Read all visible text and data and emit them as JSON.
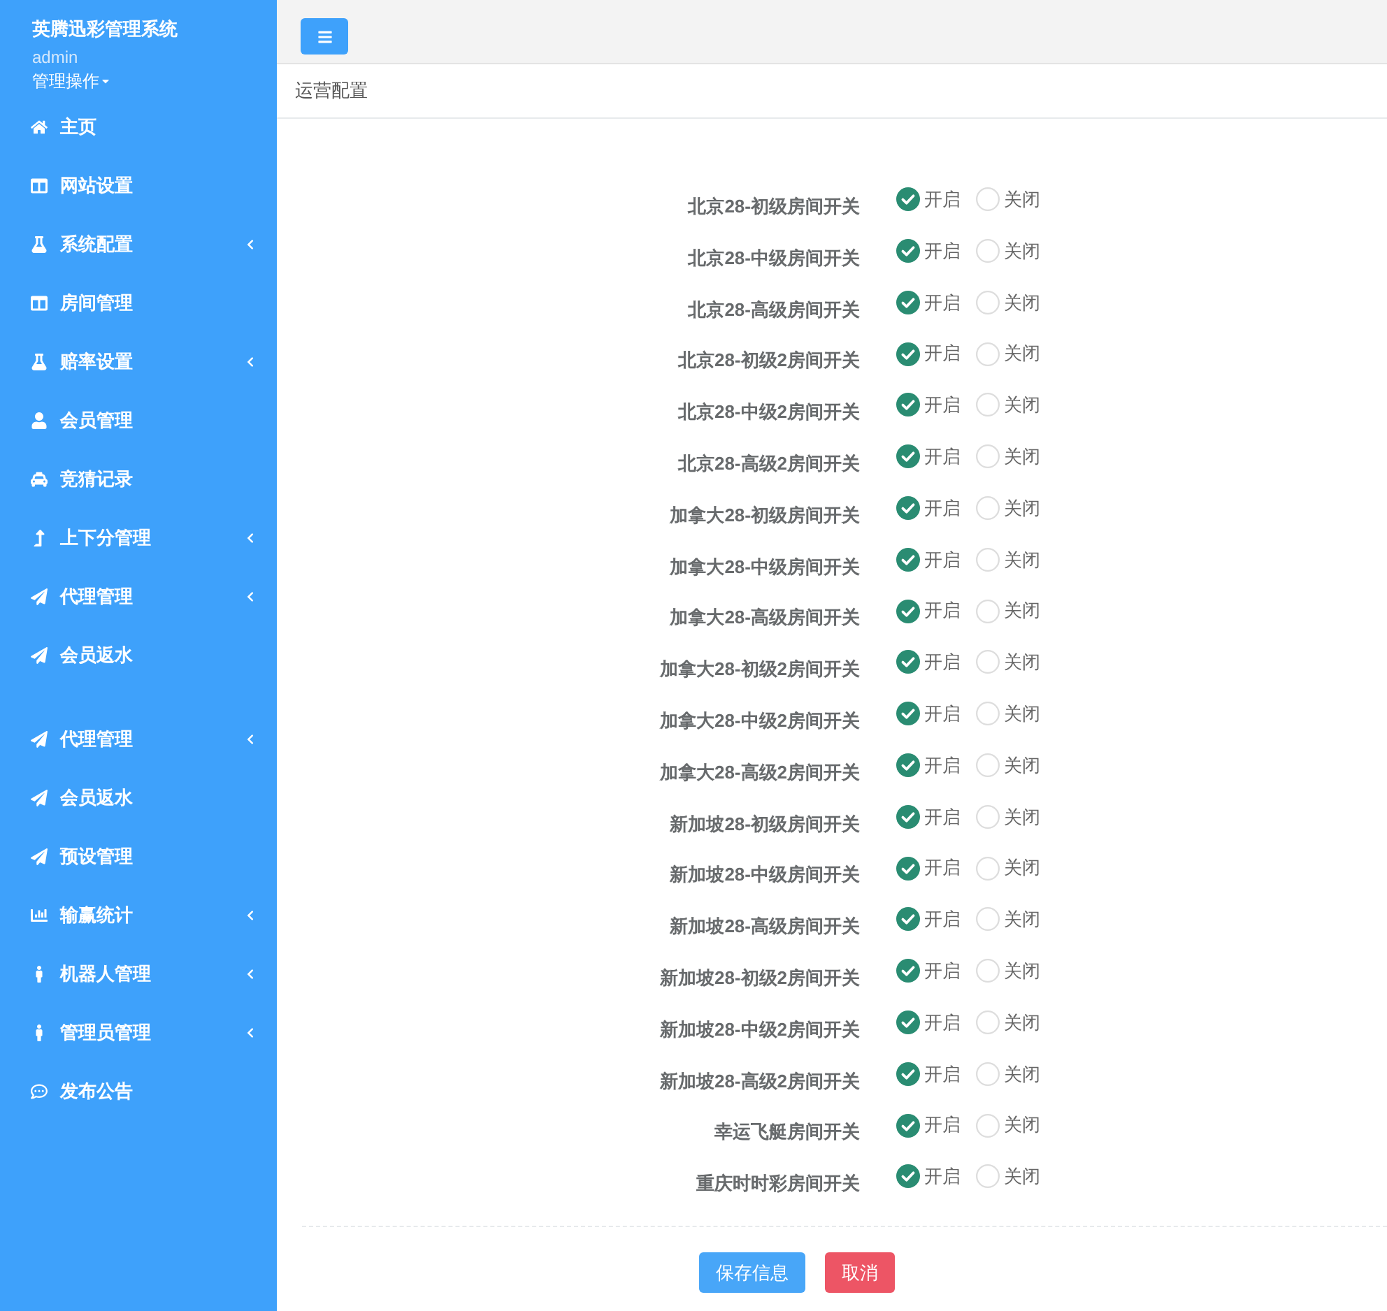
{
  "sidebar": {
    "title": "英腾迅彩管理系统",
    "user": "admin",
    "user_menu": "管理操作",
    "menu_groups": [
      {
        "items": [
          {
            "label": "主页",
            "expandable": false
          },
          {
            "label": "网站设置",
            "expandable": false
          },
          {
            "label": "系统配置",
            "expandable": true
          },
          {
            "label": "房间管理",
            "expandable": false
          },
          {
            "label": "赔率设置",
            "expandable": true
          },
          {
            "label": "会员管理",
            "expandable": false
          },
          {
            "label": "竞猜记录",
            "expandable": false
          },
          {
            "label": "上下分管理",
            "expandable": true
          },
          {
            "label": "代理管理",
            "expandable": true
          },
          {
            "label": "会员返水",
            "expandable": false
          }
        ]
      },
      {
        "items": [
          {
            "label": "代理管理",
            "expandable": true
          },
          {
            "label": "会员返水",
            "expandable": false
          },
          {
            "label": "预设管理",
            "expandable": false
          },
          {
            "label": "输赢统计",
            "expandable": true
          },
          {
            "label": "机器人管理",
            "expandable": true
          },
          {
            "label": "管理员管理",
            "expandable": true
          },
          {
            "label": "发布公告",
            "expandable": false
          }
        ]
      }
    ]
  },
  "page": {
    "title": "运营配置"
  },
  "form": {
    "rows": [
      {
        "label": "北京28-初级房间开关",
        "options": [
          {
            "label": "开启",
            "selected": true
          },
          {
            "label": "关闭",
            "selected": false
          }
        ]
      },
      {
        "label": "北京28-中级房间开关",
        "options": [
          {
            "label": "开启",
            "selected": true
          },
          {
            "label": "关闭",
            "selected": false
          }
        ]
      },
      {
        "label": "北京28-高级房间开关",
        "options": [
          {
            "label": "开启",
            "selected": true
          },
          {
            "label": "关闭",
            "selected": false
          }
        ]
      },
      {
        "label": "北京28-初级2房间开关",
        "options": [
          {
            "label": "开启",
            "selected": true
          },
          {
            "label": "关闭",
            "selected": false
          }
        ]
      },
      {
        "label": "北京28-中级2房间开关",
        "options": [
          {
            "label": "开启",
            "selected": true
          },
          {
            "label": "关闭",
            "selected": false
          }
        ]
      },
      {
        "label": "北京28-高级2房间开关",
        "options": [
          {
            "label": "开启",
            "selected": true
          },
          {
            "label": "关闭",
            "selected": false
          }
        ]
      },
      {
        "label": "加拿大28-初级房间开关",
        "options": [
          {
            "label": "开启",
            "selected": true
          },
          {
            "label": "关闭",
            "selected": false
          }
        ]
      },
      {
        "label": "加拿大28-中级房间开关",
        "options": [
          {
            "label": "开启",
            "selected": true
          },
          {
            "label": "关闭",
            "selected": false
          }
        ]
      },
      {
        "label": "加拿大28-高级房间开关",
        "options": [
          {
            "label": "开启",
            "selected": true
          },
          {
            "label": "关闭",
            "selected": false
          }
        ]
      },
      {
        "label": "加拿大28-初级2房间开关",
        "options": [
          {
            "label": "开启",
            "selected": true
          },
          {
            "label": "关闭",
            "selected": false
          }
        ]
      },
      {
        "label": "加拿大28-中级2房间开关",
        "options": [
          {
            "label": "开启",
            "selected": true
          },
          {
            "label": "关闭",
            "selected": false
          }
        ]
      },
      {
        "label": "加拿大28-高级2房间开关",
        "options": [
          {
            "label": "开启",
            "selected": true
          },
          {
            "label": "关闭",
            "selected": false
          }
        ]
      },
      {
        "label": "新加坡28-初级房间开关",
        "options": [
          {
            "label": "开启",
            "selected": true
          },
          {
            "label": "关闭",
            "selected": false
          }
        ]
      },
      {
        "label": "新加坡28-中级房间开关",
        "options": [
          {
            "label": "开启",
            "selected": true
          },
          {
            "label": "关闭",
            "selected": false
          }
        ]
      },
      {
        "label": "新加坡28-高级房间开关",
        "options": [
          {
            "label": "开启",
            "selected": true
          },
          {
            "label": "关闭",
            "selected": false
          }
        ]
      },
      {
        "label": "新加坡28-初级2房间开关",
        "options": [
          {
            "label": "开启",
            "selected": true
          },
          {
            "label": "关闭",
            "selected": false
          }
        ]
      },
      {
        "label": "新加坡28-中级2房间开关",
        "options": [
          {
            "label": "开启",
            "selected": true
          },
          {
            "label": "关闭",
            "selected": false
          }
        ]
      },
      {
        "label": "新加坡28-高级2房间开关",
        "options": [
          {
            "label": "开启",
            "selected": true
          },
          {
            "label": "关闭",
            "selected": false
          }
        ]
      },
      {
        "label": "幸运飞艇房间开关",
        "options": [
          {
            "label": "开启",
            "selected": true
          },
          {
            "label": "关闭",
            "selected": false
          }
        ]
      },
      {
        "label": "重庆时时彩房间开关",
        "options": [
          {
            "label": "开启",
            "selected": true
          },
          {
            "label": "关闭",
            "selected": false
          }
        ]
      }
    ]
  },
  "buttons": [
    {
      "label": "保存信息",
      "kind": "primary"
    },
    {
      "label": "取消",
      "kind": "danger"
    }
  ]
}
